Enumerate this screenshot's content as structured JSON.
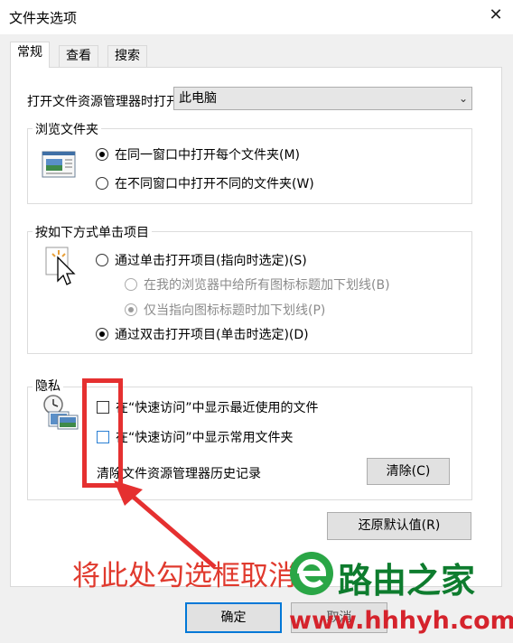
{
  "window": {
    "title": "文件夹选项",
    "close_glyph": "✕"
  },
  "tabs": [
    {
      "label": "常规"
    },
    {
      "label": "查看"
    },
    {
      "label": "搜索"
    }
  ],
  "open_in": {
    "label": "打开文件资源管理器时打开:",
    "value": "此电脑"
  },
  "browse": {
    "title": "浏览文件夹",
    "options": [
      "在同一窗口中打开每个文件夹(M)",
      "在不同窗口中打开不同的文件夹(W)"
    ],
    "selected": 0
  },
  "click": {
    "title": "按如下方式单击项目",
    "single": "通过单击打开项目(指向时选定)(S)",
    "sub1": "在我的浏览器中给所有图标标题加下划线(B)",
    "sub2": "仅当指向图标标题时加下划线(P)",
    "double": "通过双击打开项目(单击时选定)(D)"
  },
  "privacy": {
    "title": "隐私",
    "recent": "在“快速访问”中显示最近使用的文件",
    "frequent": "在“快速访问”中显示常用文件夹",
    "clear_label": "清除文件资源管理器历史记录",
    "clear_button": "清除(C)"
  },
  "restore_button": "还原默认值(R)",
  "ok_button": "确定",
  "cancel_button": "取消",
  "annotation": "将此处勾选框取消掉",
  "watermark": {
    "brand": "路由之家",
    "url": "www.hhhyh.com"
  },
  "colors": {
    "accent": "#0078d7",
    "annotation": "#e53030",
    "watermark_green": "#0e7c2e",
    "watermark_red": "#d5232c"
  }
}
